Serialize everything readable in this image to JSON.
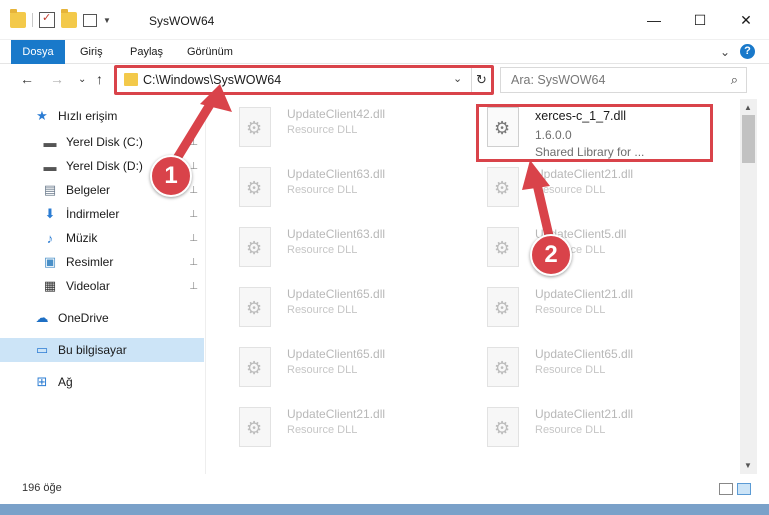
{
  "window": {
    "title": "SysWOW64",
    "minimize_glyph": "—",
    "maximize_glyph": "☐",
    "close_glyph": "✕"
  },
  "ribbon": {
    "tabs": [
      "Dosya",
      "Giriş",
      "Paylaş",
      "Görünüm"
    ],
    "expand_glyph": "⌄",
    "help_glyph": "?"
  },
  "nav": {
    "back_glyph": "←",
    "forward_glyph": "→",
    "recent_glyph": "⌄",
    "up_glyph": "↑",
    "address": "C:\\Windows\\SysWOW64",
    "address_dropdown_glyph": "⌄",
    "refresh_glyph": "↻",
    "search_placeholder": "Ara: SysWOW64",
    "search_glyph": "⌕"
  },
  "sidebar": {
    "items": [
      {
        "label": "Hızlı erişim",
        "icon": "star-icon",
        "glyph": "★",
        "color": "#2b7cd3",
        "pinned": false
      },
      {
        "label": "Yerel Disk (C:)",
        "icon": "drive-icon",
        "glyph": "▬",
        "color": "#555555",
        "pinned": true
      },
      {
        "label": "Yerel Disk (D:)",
        "icon": "drive-icon",
        "glyph": "▬",
        "color": "#555555",
        "pinned": true
      },
      {
        "label": "Belgeler",
        "icon": "documents-icon",
        "glyph": "▤",
        "color": "#6b7b8c",
        "pinned": true
      },
      {
        "label": "İndirmeler",
        "icon": "download-icon",
        "glyph": "⬇",
        "color": "#2b7cd3",
        "pinned": true
      },
      {
        "label": "Müzik",
        "icon": "music-icon",
        "glyph": "♪",
        "color": "#2b7cd3",
        "pinned": true
      },
      {
        "label": "Resimler",
        "icon": "pictures-icon",
        "glyph": "▣",
        "color": "#4a90c8",
        "pinned": true
      },
      {
        "label": "Videolar",
        "icon": "videos-icon",
        "glyph": "▦",
        "color": "#333333",
        "pinned": true
      },
      {
        "label": "OneDrive",
        "icon": "cloud-icon",
        "glyph": "☁",
        "color": "#1e6fc4",
        "pinned": false
      },
      {
        "label": "Bu bilgisayar",
        "icon": "computer-icon",
        "glyph": "▭",
        "color": "#2b7cd3",
        "pinned": false,
        "selected": true
      },
      {
        "label": "Ağ",
        "icon": "network-icon",
        "glyph": "⊞",
        "color": "#2b7cd3",
        "pinned": false
      }
    ],
    "pin_glyph": "📌"
  },
  "files": {
    "left_column": [
      {
        "name": "UpdateClient42.dll",
        "desc": "Resource DLL"
      },
      {
        "name": "UpdateClient63.dll",
        "desc": "Resource DLL"
      },
      {
        "name": "UpdateClient63.dll",
        "desc": "Resource DLL"
      },
      {
        "name": "UpdateClient65.dll",
        "desc": "Resource DLL"
      },
      {
        "name": "UpdateClient65.dll",
        "desc": "Resource DLL"
      },
      {
        "name": "UpdateClient21.dll",
        "desc": "Resource DLL"
      }
    ],
    "right_column": [
      {
        "name": "xerces-c_1_7.dll",
        "desc": "1.6.0.0",
        "desc2": "Shared Library for ...",
        "active": true
      },
      {
        "name": "UpdateClient21.dll",
        "desc": "Resource DLL"
      },
      {
        "name": "UpdateClient5.dll",
        "desc": "Resource DLL"
      },
      {
        "name": "UpdateClient21.dll",
        "desc": "Resource DLL"
      },
      {
        "name": "UpdateClient65.dll",
        "desc": "Resource DLL"
      },
      {
        "name": "UpdateClient21.dll",
        "desc": "Resource DLL"
      }
    ]
  },
  "status": {
    "item_count": "196 öğe"
  },
  "annotations": {
    "badge_1": "1",
    "badge_2": "2",
    "color": "#d9434a"
  }
}
